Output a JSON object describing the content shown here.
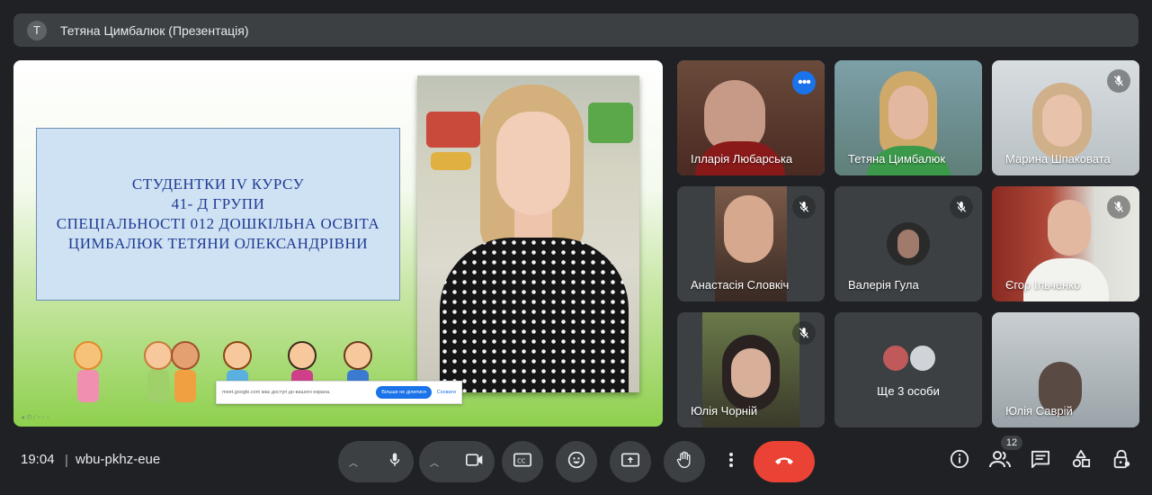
{
  "presenter_banner": {
    "avatar_letter": "T",
    "text": "Тетяна Цимбалюк (Презентація)"
  },
  "slide": {
    "lines": [
      "СТУДЕНТКИ IV КУРСУ",
      "41- Д ГРУПИ",
      "СПЕЦІАЛЬНОСТІ 012 ДОШКІЛЬНА ОСВІТА",
      "ЦИМБАЛЮК ТЕТЯНИ ОЛЕКСАНДРІВНИ"
    ]
  },
  "share_bar": {
    "message": "meet.google.com має доступ до вашого екрана.",
    "stop_label": "Більше не ділитися",
    "hide_label": "Сховати"
  },
  "participants": [
    {
      "name": "Ілларія Любарська",
      "state": "active"
    },
    {
      "name": "Тетяна Цимбалюк",
      "state": "unmuted"
    },
    {
      "name": "Марина Шпаковата",
      "state": "muted"
    },
    {
      "name": "Анастасія Словкіч",
      "state": "muted"
    },
    {
      "name": "Валерія Гула",
      "state": "muted"
    },
    {
      "name": "Єгор Ільченко",
      "state": "muted"
    },
    {
      "name": "Юлія Чорній",
      "state": "muted"
    },
    {
      "name": "Юлія Саврій",
      "state": "unmuted"
    }
  ],
  "others_tile": {
    "label": "Ще 3 особи"
  },
  "meeting": {
    "time": "19:04",
    "separator": "|",
    "code": "wbu-pkhz-eue"
  },
  "people_count": "12",
  "colors": {
    "end_call": "#ea4335",
    "accent": "#1a73e8",
    "active_outline": "#8ab4f8"
  }
}
